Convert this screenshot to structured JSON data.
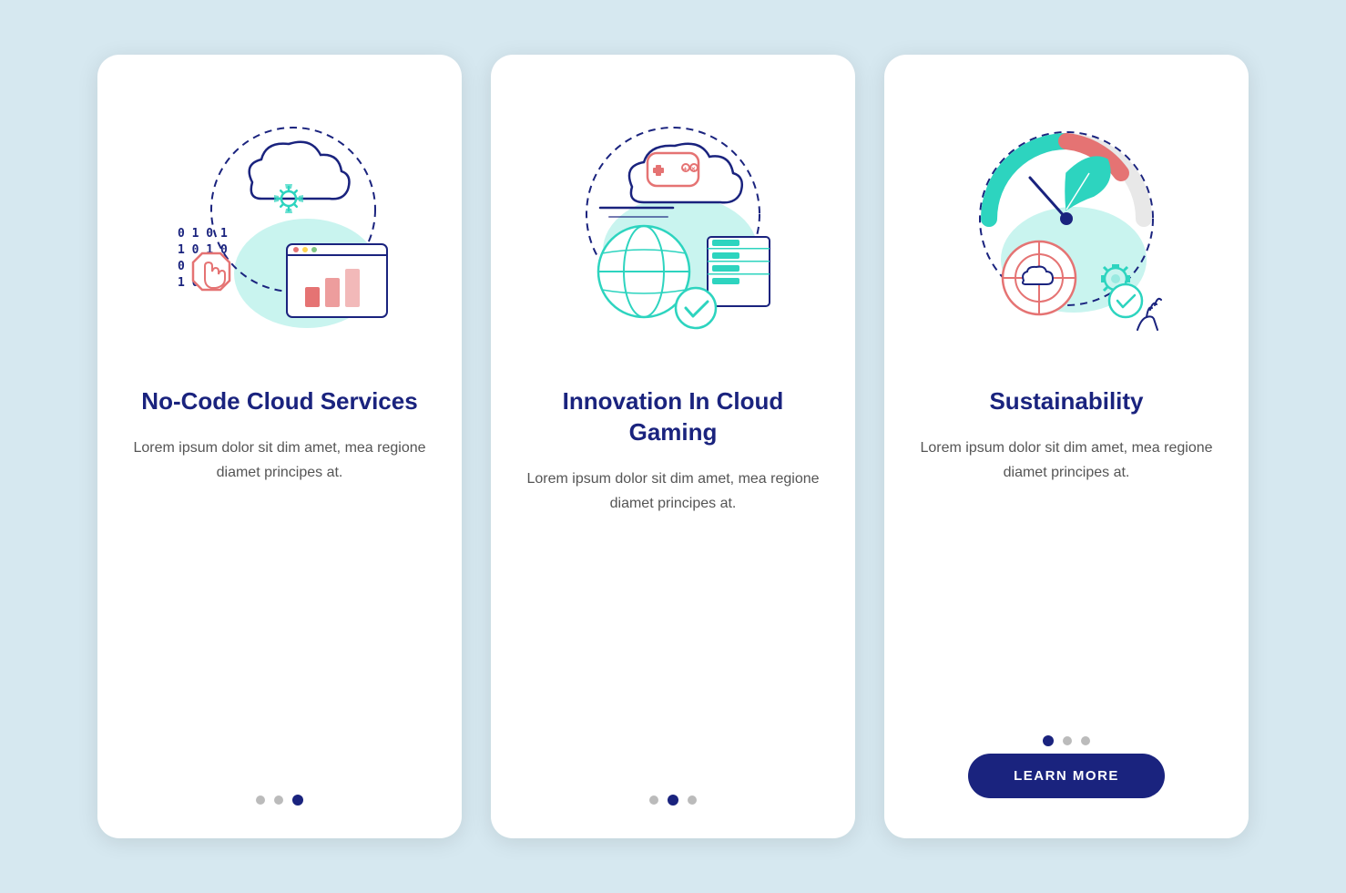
{
  "background_color": "#d6e8f0",
  "cards": [
    {
      "id": "card-1",
      "title": "No-Code Cloud Services",
      "body": "Lorem ipsum dolor sit dim amet, mea regione diamet principes at.",
      "dots": [
        "inactive",
        "inactive",
        "active"
      ],
      "button": null,
      "illustration": "nocode"
    },
    {
      "id": "card-2",
      "title": "Innovation In Cloud Gaming",
      "body": "Lorem ipsum dolor sit dim amet, mea regione diamet principes at.",
      "dots": [
        "inactive",
        "active",
        "inactive"
      ],
      "button": null,
      "illustration": "gaming"
    },
    {
      "id": "card-3",
      "title": "Sustainability",
      "body": "Lorem ipsum dolor sit dim amet, mea regione diamet principes at.",
      "dots": [
        "active",
        "inactive",
        "inactive"
      ],
      "button": "LEARN MORE",
      "illustration": "sustainability"
    }
  ]
}
